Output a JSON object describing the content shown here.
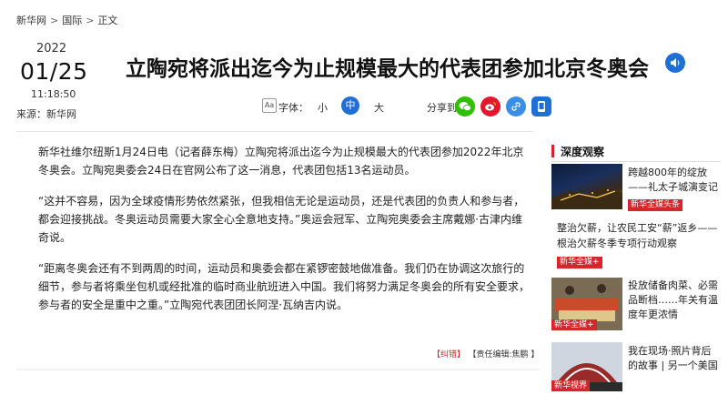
{
  "breadcrumb": [
    "新华网",
    "国际",
    "正文"
  ],
  "breadcrumb_sep": ">",
  "date": {
    "year": "2022",
    "month_day": "01/25",
    "time": "11:18:50",
    "source": "来源：新华网"
  },
  "title": "立陶宛将派出迄今为止规模最大的代表团参加北京冬奥会",
  "tools": {
    "font_label": "字体：",
    "font_small": "小",
    "font_medium": "中",
    "font_large": "大",
    "share_label": "分享到："
  },
  "article": {
    "paragraphs": [
      "新华社维尔纽斯1月24日电（记者薛东梅）立陶宛将派出迄今为止规模最大的代表团参加2022年北京冬奥会。立陶宛奥委会24日在官网公布了这一消息，代表团包括13名运动员。",
      "“这并不容易，因为全球疫情形势依然紧张，但我相信无论是运动员，还是代表团的负责人和参与者，都会迎接挑战。冬奥运动员需要大家全心全意地支持。”奥运会冠军、立陶宛奥委会主席戴娜·古津内维奇说。",
      "“距离冬奥会还有不到两周的时间，运动员和奥委会都在紧锣密鼓地做准备。我们仍在协调这次旅行的细节，参与者将乘坐包机或经批准的临时商业航班进入中国。我们将努力满足冬奥会的所有安全要求，参与者的安全是重中之重。”立陶宛代表团团长阿涅·瓦纳吉内说。"
    ],
    "correction": "【纠错】",
    "editor": "【责任编辑:焦鹏 】"
  },
  "sidebar": {
    "heading": "深度观察",
    "items": [
      {
        "title": "跨越800年的绽放——礼太子城演变记",
        "tag": "新华全媒头条"
      },
      {
        "title": "整治欠薪，让农民工安“薪”返乡——根治欠薪冬季专项行动观察",
        "tag": "新华全媒+"
      },
      {
        "title": "投放储备肉菜、必需品断档……年关有温度年更浓情",
        "tag": "新华全媒+"
      },
      {
        "title": "我在现场·照片背后的故事 | 另一个美国",
        "tag": "新华视界"
      }
    ]
  },
  "colors": {
    "accent_blue": "#1f6fd6",
    "tag_red": "#d6262b",
    "wechat": "#2dc100",
    "weibo": "#e6162d",
    "link": "#3a8ee6",
    "phone": "#1f6fd6"
  }
}
